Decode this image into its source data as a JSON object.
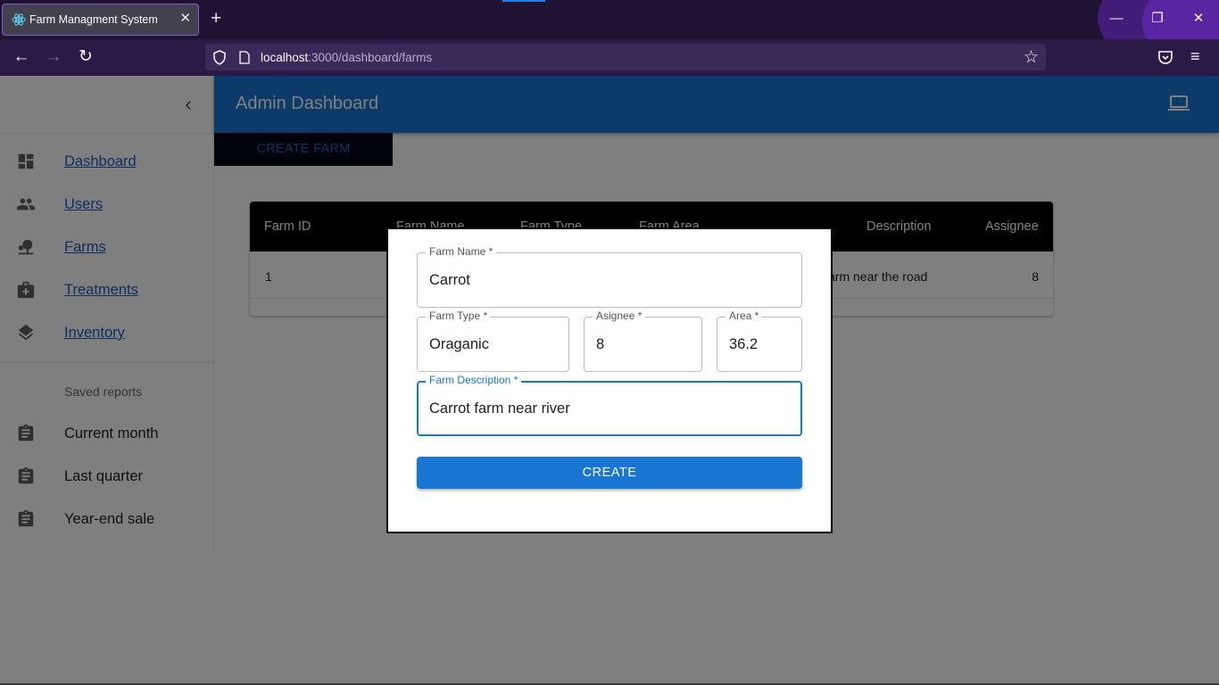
{
  "browser": {
    "tab_title": "Farm Managment System",
    "url_host": "localhost",
    "url_path": ":3000/dashboard/farms"
  },
  "sidebar": {
    "nav_items": [
      {
        "label": "Dashboard",
        "icon": "dashboard-icon"
      },
      {
        "label": "Users",
        "icon": "people-icon"
      },
      {
        "label": "Farms",
        "icon": "park-icon"
      },
      {
        "label": "Treatments",
        "icon": "medical-kit-icon"
      },
      {
        "label": "Inventory",
        "icon": "layers-icon"
      }
    ],
    "reports_header": "Saved reports",
    "reports": [
      {
        "label": "Current month",
        "icon": "clipboard-icon"
      },
      {
        "label": "Last quarter",
        "icon": "clipboard-icon"
      },
      {
        "label": "Year-end sale",
        "icon": "clipboard-icon"
      }
    ]
  },
  "appbar": {
    "title": "Admin Dashboard",
    "icon": "laptop-icon",
    "color": "#1976d2"
  },
  "toolbar": {
    "create_farm_label": "CREATE FARM"
  },
  "table": {
    "columns": [
      "Farm ID",
      "Farm Name",
      "Farm Type",
      "Farm Area",
      "Description",
      "Assignee"
    ],
    "rows": [
      {
        "id": "1",
        "description": "arm near the road",
        "assignee": "8"
      }
    ]
  },
  "modal": {
    "fields": {
      "farm_name": {
        "label": "Farm Name *",
        "value": "Carrot"
      },
      "farm_type": {
        "label": "Farm Type *",
        "value": "Oraganic"
      },
      "assignee": {
        "label": "Asignee *",
        "value": "8"
      },
      "area": {
        "label": "Area *",
        "value": "36.2"
      },
      "description": {
        "label": "Farm Description *",
        "value": "Carrot farm near river"
      }
    },
    "submit_label": "CREATE"
  }
}
